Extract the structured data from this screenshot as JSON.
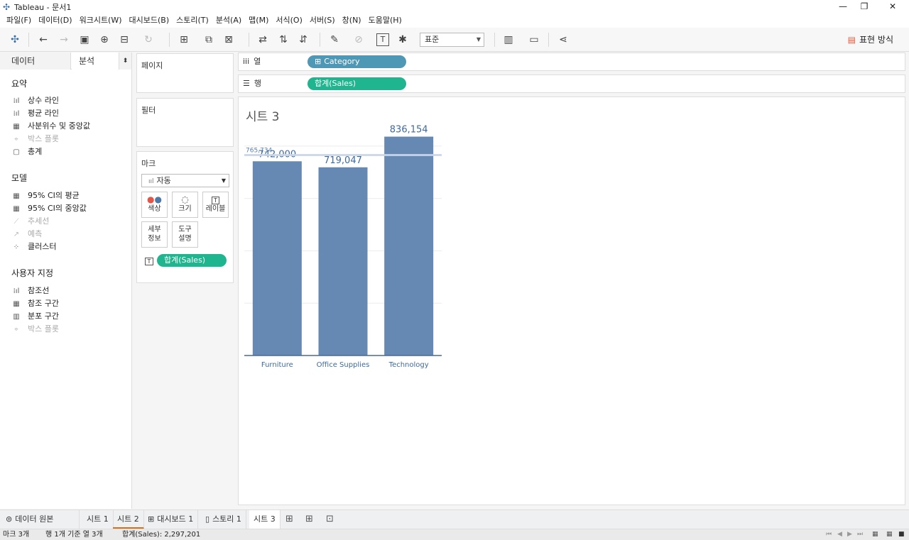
{
  "window": {
    "title": "Tableau - 문서1",
    "minimize": "—",
    "maximize": "❐",
    "close": "✕"
  },
  "menu": [
    "파일(F)",
    "데이터(D)",
    "워크시트(W)",
    "대시보드(B)",
    "스토리(T)",
    "분석(A)",
    "맵(M)",
    "서식(O)",
    "서버(S)",
    "창(N)",
    "도움말(H)"
  ],
  "toolbar": {
    "fit_select": "표준",
    "show_me": "표현 방식"
  },
  "left_panel": {
    "tabs": {
      "data": "데이터",
      "analytics": "분석"
    },
    "summary": {
      "title": "요약",
      "items": [
        {
          "label": "상수 라인",
          "icon": "constant-line-icon",
          "enabled": true
        },
        {
          "label": "평균 라인",
          "icon": "average-line-icon",
          "enabled": true
        },
        {
          "label": "사분위수 및 중앙값",
          "icon": "quartile-icon",
          "enabled": true
        },
        {
          "label": "박스 플롯",
          "icon": "box-plot-icon",
          "enabled": false
        },
        {
          "label": "총계",
          "icon": "totals-icon",
          "enabled": true
        }
      ]
    },
    "model": {
      "title": "모델",
      "items": [
        {
          "label": "95% CI의 평균",
          "icon": "ci-mean-icon",
          "enabled": true
        },
        {
          "label": "95% CI의 중앙값",
          "icon": "ci-median-icon",
          "enabled": true
        },
        {
          "label": "추세선",
          "icon": "trend-line-icon",
          "enabled": false
        },
        {
          "label": "예측",
          "icon": "forecast-icon",
          "enabled": false
        },
        {
          "label": "클러스터",
          "icon": "cluster-icon",
          "enabled": true
        }
      ]
    },
    "custom": {
      "title": "사용자 지정",
      "items": [
        {
          "label": "참조선",
          "icon": "reference-line-icon",
          "enabled": true
        },
        {
          "label": "참조 구간",
          "icon": "reference-band-icon",
          "enabled": true
        },
        {
          "label": "분포 구간",
          "icon": "distribution-band-icon",
          "enabled": true
        },
        {
          "label": "박스 플롯",
          "icon": "box-plot-icon",
          "enabled": false
        }
      ]
    }
  },
  "cards": {
    "pages": "페이지",
    "filters": "필터",
    "marks": {
      "title": "마크",
      "type": "자동",
      "buttons": {
        "color": "색상",
        "size": "크기",
        "label": "레이블",
        "detail": "세부\n정보",
        "tooltip": "도구\n설명"
      },
      "pill": "합계(Sales)"
    }
  },
  "shelves": {
    "columns": {
      "label": "열",
      "pill": "Category"
    },
    "rows": {
      "label": "행",
      "pill": "합계(Sales)"
    }
  },
  "sheet_title": "시트 3",
  "chart_data": {
    "type": "bar",
    "categories": [
      "Furniture",
      "Office Supplies",
      "Technology"
    ],
    "values": [
      742000,
      719047,
      836154
    ],
    "value_labels": [
      "742,000",
      "719,047",
      "836,154"
    ],
    "reference_line": {
      "value": 765734,
      "label": "765,734"
    },
    "ylim": [
      0,
      900000
    ],
    "grid": true,
    "bar_color": "#6589b2",
    "label_color": "#3f6a9c"
  },
  "tabs": {
    "data_source": "데이터 원본",
    "sheets": [
      "시트 1",
      "시트 2",
      "대시보드 1",
      "스토리 1",
      "시트 3"
    ]
  },
  "status": {
    "marks": "마크 3개",
    "rows_cols": "행 1개 기준 열 3개",
    "sum": "합계(Sales): 2,297,201"
  }
}
